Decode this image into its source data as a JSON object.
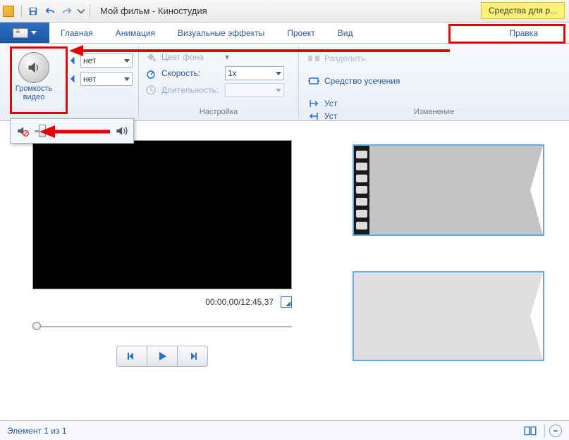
{
  "titlebar": {
    "title": "Мой фильм - Киностудия",
    "tools_tab": "Средства для р..."
  },
  "tabs": {
    "main": "Главная",
    "animation": "Анимация",
    "effects": "Визуальные эффекты",
    "project": "Проект",
    "view": "Вид",
    "edit": "Правка"
  },
  "ribbon": {
    "volume_label": "Громкость видео",
    "fade_in_val": "нет",
    "fade_out_val": "нет",
    "bg_color": "Цвет фона",
    "speed_label": "Скорость:",
    "speed_val": "1x",
    "duration_label": "Длительность:",
    "group_settings": "Настройка",
    "split": "Разделить",
    "trim_tool": "Средство усечения",
    "set_start": "Уст",
    "set_end": "Уст",
    "group_change": "Изменение"
  },
  "preview": {
    "time": "00:00,00/12:45,37"
  },
  "status": {
    "items": "Элемент 1 из 1",
    "zoom_out": "−"
  }
}
